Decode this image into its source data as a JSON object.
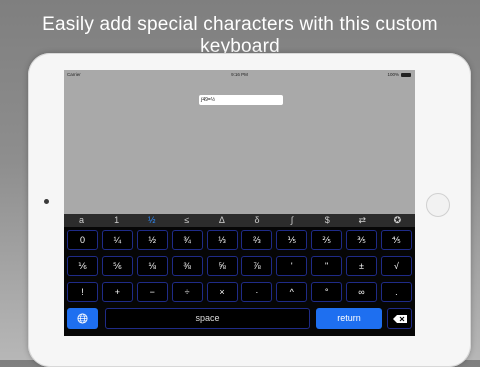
{
  "headline": "Easily add special characters with this custom keyboard",
  "status_bar": {
    "carrier": "Carrier",
    "time": "9:16 PM",
    "battery": "100%"
  },
  "text_field": {
    "value": "∫49=½"
  },
  "keyboard": {
    "category_bar": [
      "a",
      "1",
      "½",
      "≤",
      "Δ",
      "δ",
      "∫",
      "$",
      "⇄",
      "✪"
    ],
    "active_category": "½",
    "rows": [
      [
        "0",
        "¼",
        "½",
        "¾",
        "⅓",
        "⅔",
        "⅕",
        "⅖",
        "⅗",
        "⅘"
      ],
      [
        "⅙",
        "⅚",
        "⅛",
        "⅜",
        "⅝",
        "⅞",
        "'",
        "\"",
        "±",
        "√"
      ],
      [
        "!",
        "+",
        "−",
        "÷",
        "×",
        "·",
        "^",
        "°",
        "∞",
        "."
      ]
    ],
    "space_label": "space",
    "return_label": "return",
    "globe_icon": "globe-icon",
    "delete_icon": "backspace-icon",
    "accent_color": "#1e6ff0"
  }
}
